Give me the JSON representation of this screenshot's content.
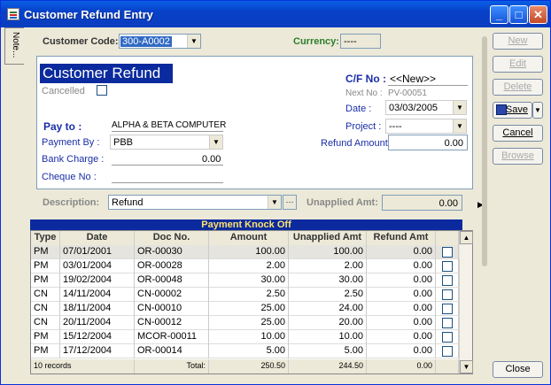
{
  "window": {
    "title": "Customer Refund Entry",
    "min": "_",
    "max": "□",
    "close": "✕"
  },
  "note_tab": "Note...",
  "top": {
    "customer_code_label": "Customer Code:",
    "customer_code": "300-A0002",
    "currency_label": "Currency:",
    "currency": "----"
  },
  "header": {
    "title": "Customer Refund",
    "cancelled": "Cancelled",
    "cf_label": "C/F No :",
    "cf_value": "<<New>>",
    "next_no_label": "Next No :",
    "next_no": "PV-00051",
    "date_label": "Date :",
    "date": "03/03/2005",
    "project_label": "Project :",
    "project": "----",
    "refund_amount_label": "Refund Amount:",
    "refund_amount": "0.00"
  },
  "pay": {
    "pay_to_label": "Pay to :",
    "pay_to": "ALPHA & BETA COMPUTER",
    "payment_by_label": "Payment By :",
    "payment_by": "PBB",
    "bank_charge_label": "Bank Charge :",
    "bank_charge": "0.00",
    "cheque_label": "Cheque No :",
    "cheque": ""
  },
  "description": {
    "label": "Description:",
    "value": "Refund",
    "more": "···",
    "unapplied_label": "Unapplied Amt:",
    "unapplied": "0.00"
  },
  "table": {
    "caption": "Payment Knock Off",
    "columns": [
      "Type",
      "Date",
      "Doc No.",
      "Amount",
      "Unapplied Amt",
      "Refund Amt"
    ],
    "rows": [
      [
        "PM",
        "07/01/2001",
        "OR-00030",
        "100.00",
        "100.00",
        "0.00"
      ],
      [
        "PM",
        "03/01/2004",
        "OR-00028",
        "2.00",
        "2.00",
        "0.00"
      ],
      [
        "PM",
        "19/02/2004",
        "OR-00048",
        "30.00",
        "30.00",
        "0.00"
      ],
      [
        "CN",
        "14/11/2004",
        "CN-00002",
        "2.50",
        "2.50",
        "0.00"
      ],
      [
        "CN",
        "18/11/2004",
        "CN-00010",
        "25.00",
        "24.00",
        "0.00"
      ],
      [
        "CN",
        "20/11/2004",
        "CN-00012",
        "25.00",
        "20.00",
        "0.00"
      ],
      [
        "PM",
        "15/12/2004",
        "MCOR-00011",
        "10.00",
        "10.00",
        "0.00"
      ],
      [
        "PM",
        "17/12/2004",
        "OR-00014",
        "5.00",
        "5.00",
        "0.00"
      ]
    ],
    "footer": {
      "records": "10 records",
      "total_label": "Total:",
      "amount": "250.50",
      "unapplied": "244.50",
      "refund": "0.00"
    }
  },
  "buttons": {
    "new": "New",
    "edit": "Edit",
    "delete": "Delete",
    "save": "Save",
    "cancel": "Cancel",
    "browse": "Browse",
    "close": "Close"
  }
}
